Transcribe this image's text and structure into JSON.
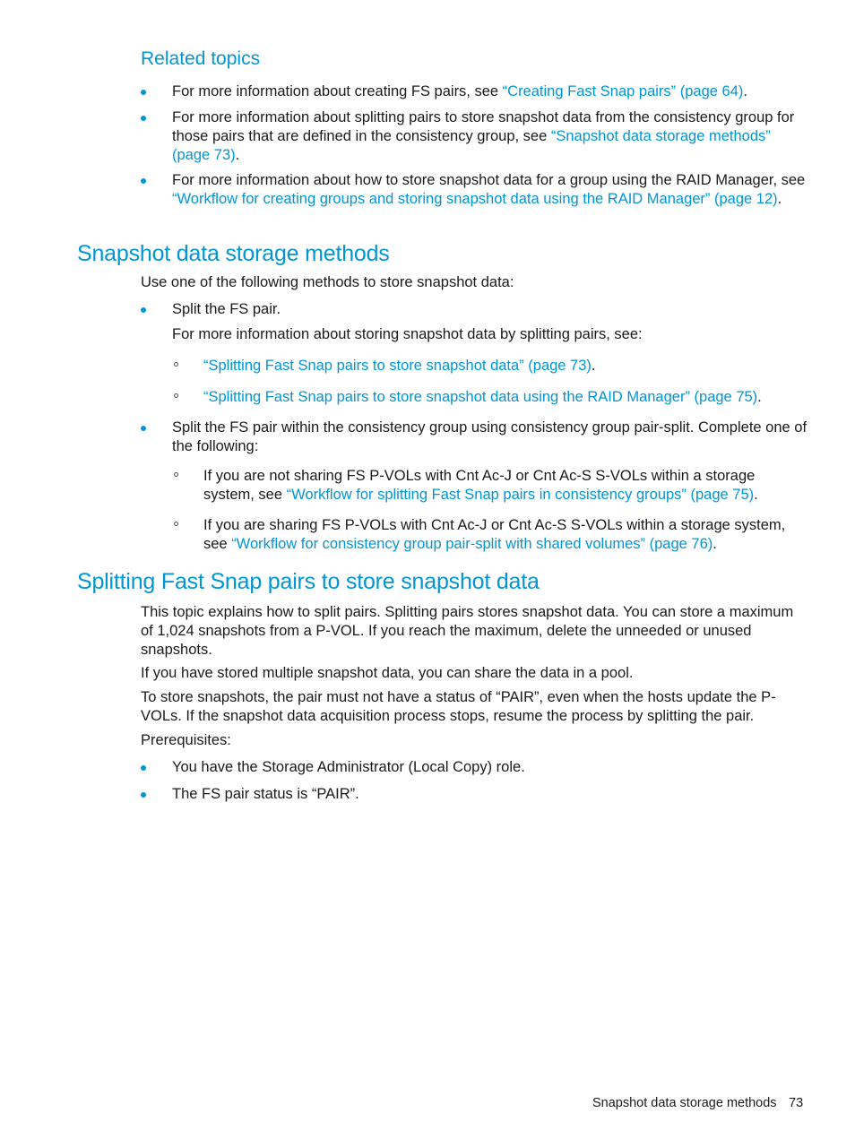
{
  "related_topics": {
    "heading": "Related topics",
    "items": [
      {
        "pre": "For more information about creating FS pairs, see ",
        "link": "“Creating Fast Snap pairs” (page 64)",
        "post": "."
      },
      {
        "pre": "For more information about splitting pairs to store snapshot data from the consistency group for those pairs that are defined in the consistency group, see ",
        "link": "“Snapshot data storage methods” (page 73)",
        "post": "."
      },
      {
        "pre": "For more information about how to store snapshot data for a group using the RAID Manager, see ",
        "link": "“Workflow for creating groups and storing snapshot data using the RAID Manager” (page 12)",
        "post": "."
      }
    ]
  },
  "section1": {
    "heading": "Snapshot data storage methods",
    "intro": "Use one of the following methods to store snapshot data:",
    "items": [
      {
        "text": "Split the FS pair.",
        "note": "For more information about storing snapshot data by splitting pairs, see:",
        "subitems": [
          {
            "pre": "",
            "link": "“Splitting Fast Snap pairs to store snapshot data” (page 73)",
            "post": "."
          },
          {
            "pre": "",
            "link": "“Splitting Fast Snap pairs to store snapshot data using the RAID Manager” (page 75)",
            "post": "."
          }
        ]
      },
      {
        "text": "Split the FS pair within the consistency group using consistency group pair-split. Complete one of the following:",
        "subitems": [
          {
            "pre": "If you are not sharing FS P-VOLs with Cnt Ac-J or Cnt Ac-S S-VOLs within a storage system, see ",
            "link": "“Workflow for splitting Fast Snap pairs in consistency groups” (page 75)",
            "post": "."
          },
          {
            "pre": "If you are sharing FS P-VOLs with Cnt Ac-J or Cnt Ac-S S-VOLs within a storage system, see ",
            "link": "“Workflow for consistency group pair-split with shared volumes” (page 76)",
            "post": "."
          }
        ]
      }
    ]
  },
  "section2": {
    "heading": "Splitting Fast Snap pairs to store snapshot data",
    "paragraphs": [
      "This topic explains how to split pairs. Splitting pairs stores snapshot data. You can store a maximum of 1,024 snapshots from a P-VOL. If you reach the maximum, delete the unneeded or unused snapshots.",
      "If you have stored multiple snapshot data, you can share the data in a pool.",
      "To store snapshots, the pair must not have a status of “PAIR”, even when the hosts update the P-VOLs. If the snapshot data acquisition process stops, resume the process by splitting the pair.",
      "Prerequisites:"
    ],
    "prerequisites": [
      "You have the Storage Administrator (Local Copy) role.",
      "The FS pair status is “PAIR”."
    ]
  },
  "footer": {
    "section_title": "Snapshot data storage methods",
    "page_number": "73"
  },
  "colors": {
    "accent": "#0096d6",
    "text": "#1a1a1a"
  }
}
